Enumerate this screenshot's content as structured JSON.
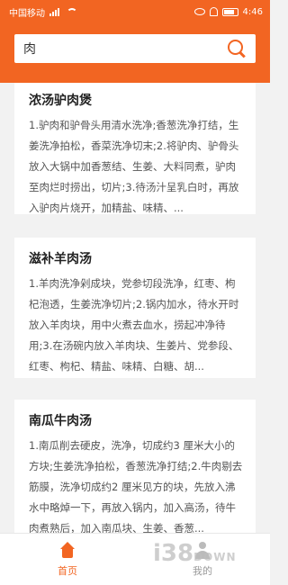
{
  "status_bar": {
    "carrier": "中国移动",
    "time": "4:46"
  },
  "search": {
    "value": "肉"
  },
  "recipes": [
    {
      "title": "浓汤驴肉煲",
      "description": "1.驴肉和驴骨头用清水洗净;香葱洗净打结，生姜洗净拍松，香菜洗净切末;2.将驴肉、驴骨头放入大锅中加香葱结、生姜、大料同煮，驴肉至肉烂时捞出，切片;3.待汤汁呈乳白时，再放入驴肉片烧开，加精盐、味精、..."
    },
    {
      "title": "滋补羊肉汤",
      "description": "1.羊肉洗净剁成块，党参切段洗净，红枣、枸杞泡透，生姜洗净切片;2.锅内加水，待水开时放入羊肉块，用中火煮去血水，捞起冲净待用;3.在汤碗内放入羊肉块、生姜片、党参段、红枣、枸杞、精盐、味精、白糖、胡..."
    },
    {
      "title": "南瓜牛肉汤",
      "description": "1.南瓜削去硬皮，洗净，切成约3 厘米大小的方块;生姜洗净拍松，香葱洗净打结;2.牛肉剔去筋膜，洗净切成约2 厘米见方的块，先放入沸水中略焯一下，再放入锅内，加入高汤，待牛肉煮熟后，加入南瓜块、生姜、香葱..."
    }
  ],
  "tabbar": {
    "home_label": "首页",
    "mine_label": "我的"
  },
  "watermark": {
    "text": "i38",
    "suffix": "DOWN"
  },
  "colors": {
    "accent": "#f26522",
    "background": "#f2f2f2"
  }
}
